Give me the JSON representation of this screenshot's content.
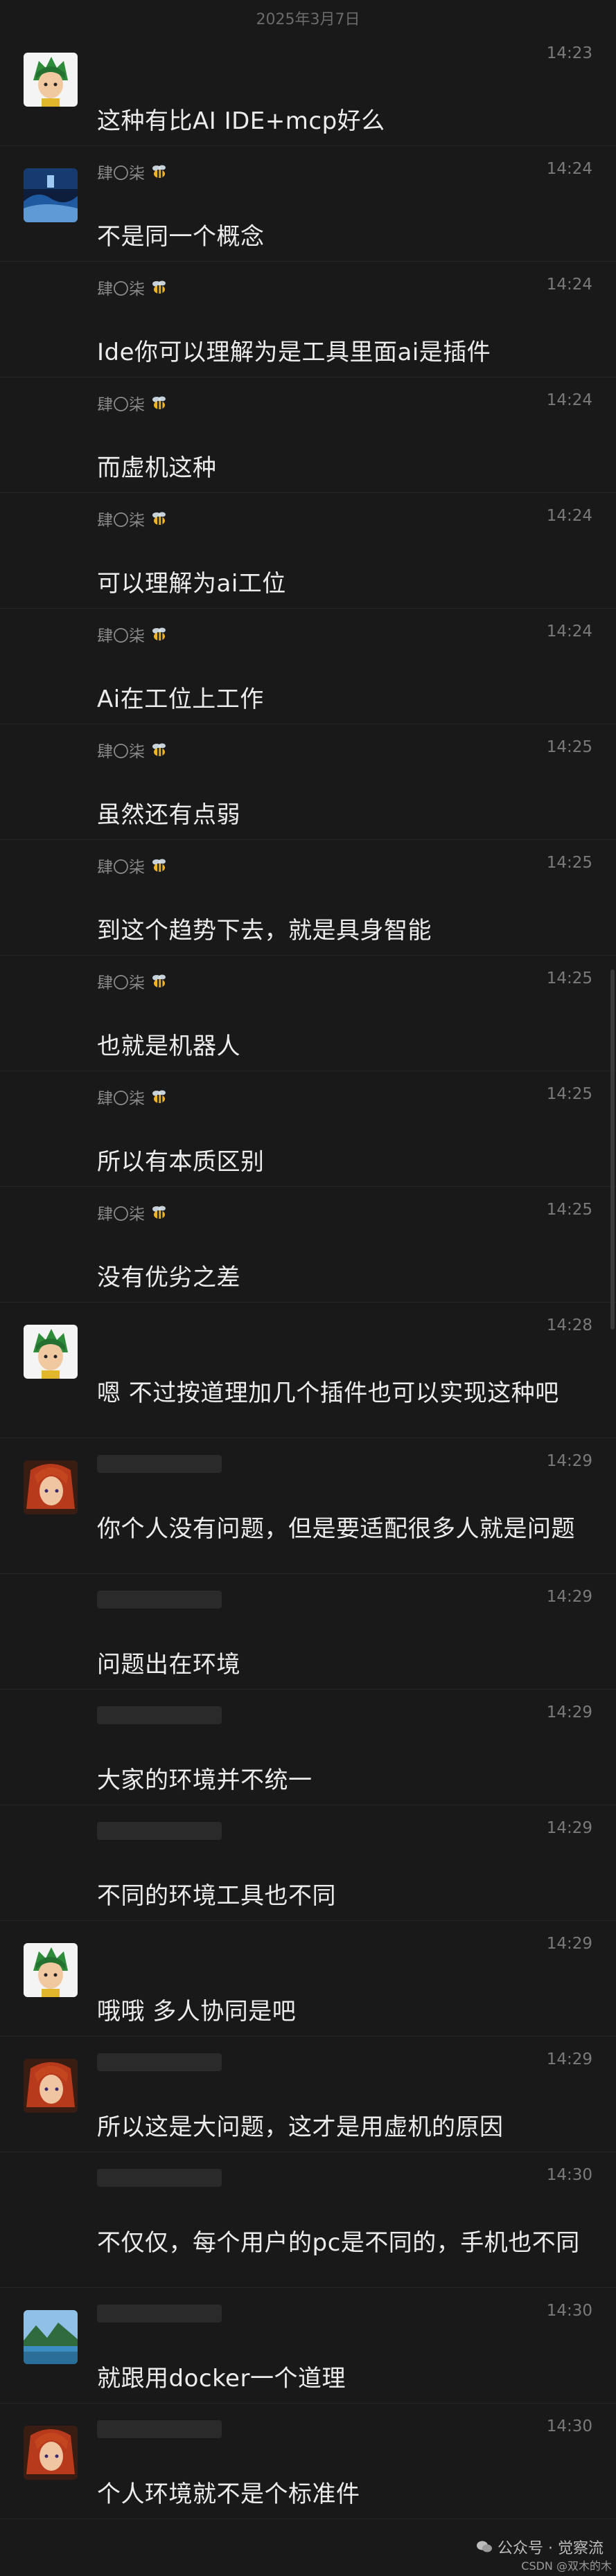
{
  "date_header": "2025年3月7日",
  "messages": [
    {
      "sender": "",
      "time": "14:23",
      "text": "这种有比AI IDE+mcp好么",
      "avatar": "green-hair-anime-avatar",
      "kind": "self"
    },
    {
      "sender": "肆〇柒",
      "time": "14:24",
      "text": "不是同一个概念",
      "avatar": "blue-landscape-avatar",
      "kind": "named"
    },
    {
      "sender": "肆〇柒",
      "time": "14:24",
      "text": "Ide你可以理解为是工具里面ai是插件",
      "avatar": "",
      "kind": "named"
    },
    {
      "sender": "肆〇柒",
      "time": "14:24",
      "text": "而虚机这种",
      "avatar": "",
      "kind": "named"
    },
    {
      "sender": "肆〇柒",
      "time": "14:24",
      "text": "可以理解为ai工位",
      "avatar": "",
      "kind": "named"
    },
    {
      "sender": "肆〇柒",
      "time": "14:24",
      "text": "Ai在工位上工作",
      "avatar": "",
      "kind": "named"
    },
    {
      "sender": "肆〇柒",
      "time": "14:25",
      "text": "虽然还有点弱",
      "avatar": "",
      "kind": "named"
    },
    {
      "sender": "肆〇柒",
      "time": "14:25",
      "text": "到这个趋势下去，就是具身智能",
      "avatar": "",
      "kind": "named"
    },
    {
      "sender": "肆〇柒",
      "time": "14:25",
      "text": "也就是机器人",
      "avatar": "",
      "kind": "named"
    },
    {
      "sender": "肆〇柒",
      "time": "14:25",
      "text": "所以有本质区别",
      "avatar": "",
      "kind": "named"
    },
    {
      "sender": "肆〇柒",
      "time": "14:25",
      "text": "没有优劣之差",
      "avatar": "",
      "kind": "named"
    },
    {
      "sender": "",
      "time": "14:28",
      "text": "嗯 不过按道理加几个插件也可以实现这种吧",
      "avatar": "green-hair-anime-avatar",
      "kind": "self-tall"
    },
    {
      "sender": "",
      "time": "14:29",
      "text": "你个人没有问题，但是要适配很多人就是问题",
      "avatar": "red-hair-anime-avatar",
      "kind": "blur-tall"
    },
    {
      "sender": "",
      "time": "14:29",
      "text": "问题出在环境",
      "avatar": "",
      "kind": "blur"
    },
    {
      "sender": "",
      "time": "14:29",
      "text": "大家的环境并不统一",
      "avatar": "",
      "kind": "blur"
    },
    {
      "sender": "",
      "time": "14:29",
      "text": "不同的环境工具也不同",
      "avatar": "",
      "kind": "blur"
    },
    {
      "sender": "",
      "time": "14:29",
      "text": "哦哦 多人协同是吧",
      "avatar": "green-hair-anime-avatar",
      "kind": "self"
    },
    {
      "sender": "",
      "time": "14:29",
      "text": "所以这是大问题，这才是用虚机的原因",
      "avatar": "red-hair-anime-avatar",
      "kind": "blur"
    },
    {
      "sender": "",
      "time": "14:30",
      "text": "不仅仅，每个用户的pc是不同的，手机也不同",
      "avatar": "",
      "kind": "blur-tall"
    },
    {
      "sender": "",
      "time": "14:30",
      "text": "就跟用docker一个道理",
      "avatar": "lake-landscape-avatar",
      "kind": "blur"
    },
    {
      "sender": "",
      "time": "14:30",
      "text": "个人环境就不是个标准件",
      "avatar": "red-hair-anime-avatar",
      "kind": "blur"
    }
  ],
  "watermark": {
    "text": "公众号 · 觉察流",
    "icon": "wechat-icon"
  },
  "csdn_mark": "CSDN @双木的木"
}
